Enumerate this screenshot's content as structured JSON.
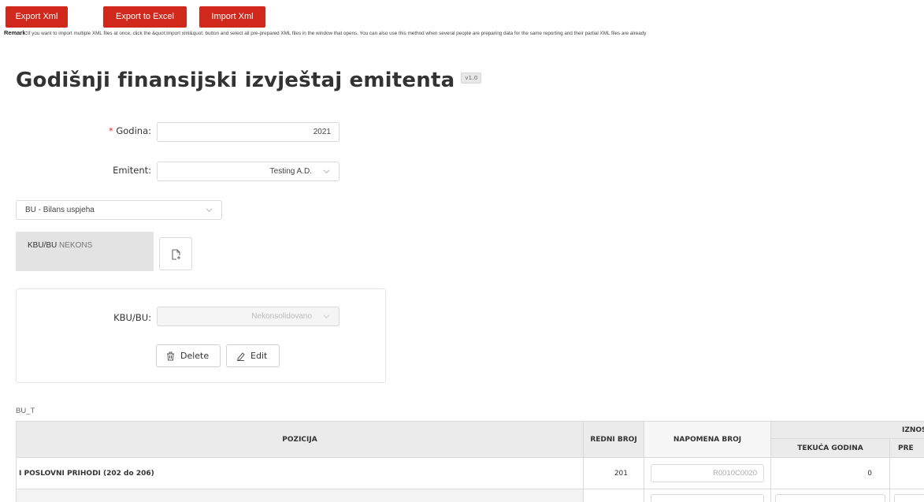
{
  "toolbar": {
    "export_xml": "Export Xml",
    "export_excel": "Export to Excel",
    "import_xml": "Import Xml"
  },
  "remark": {
    "label": "Remark:",
    "text": "If you want to import multiple XML files at once, click the &quot;Import xml&quot; button and select all pre-prepared XML files in the window that opens. You can also use this method when several people are preparing data for the same reporting and their partial XML files are already"
  },
  "page": {
    "title": "Godišnji finansijski izvještaj emitenta",
    "version": "v1.0"
  },
  "form": {
    "godina_label": "Godina:",
    "godina_value": "2021",
    "emitent_label": "Emitent:",
    "emitent_value": "Testing A.D.",
    "report_select": "BU - Bilans uspjeha"
  },
  "tab": {
    "strong": "KBU/BU",
    "rest": "NEKONS"
  },
  "panel": {
    "kbu_label": "KBU/BU:",
    "kbu_value": "Nekonsolidovano",
    "delete_label": "Delete",
    "edit_label": "Edit"
  },
  "table": {
    "caption": "BU_T",
    "headers": {
      "pozicija": "POZICIJA",
      "redni_broj": "REDNI BROJ",
      "napomena_broj": "NAPOMENA BROJ",
      "iznos": "IZNOS",
      "tekuca_godina": "TEKUĆA GODINA",
      "prethodna": "PRE"
    },
    "rows": [
      {
        "pozicija": "I POSLOVNI PRIHODI (202 do 206)",
        "redni_broj": "201",
        "napomena": "R0010C0020",
        "tekuca": "0"
      }
    ]
  },
  "colors": {
    "accent_red": "#d0281b",
    "header_gray": "#ebebeb"
  }
}
